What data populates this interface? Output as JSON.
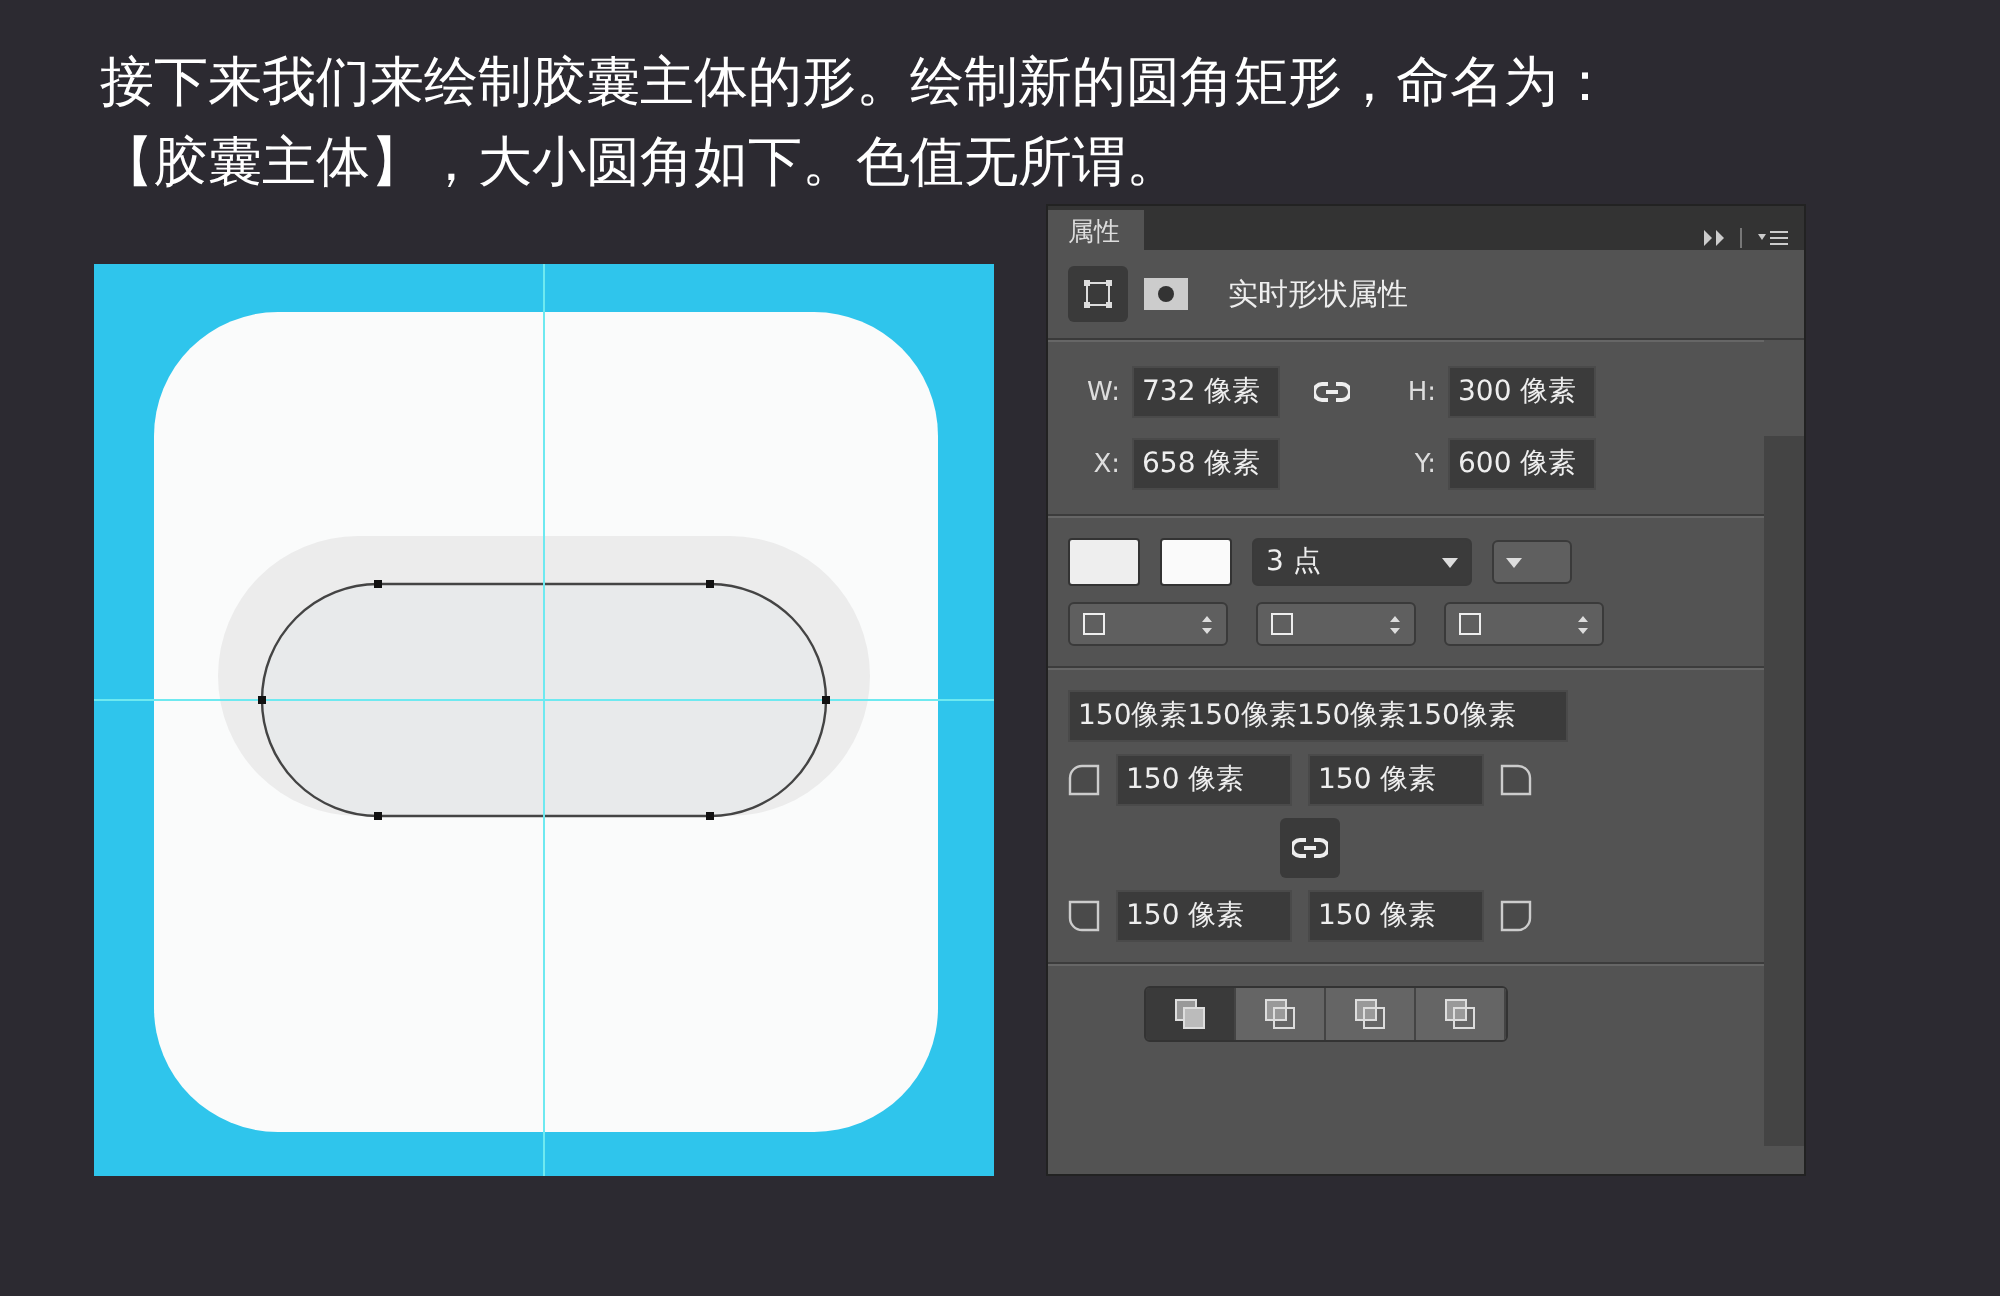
{
  "instruction": {
    "lines": [
      "接下来我们来绘制胶囊主体的形。绘制新的圆角矩形，命名为：",
      "【胶囊主体】，大小圆角如下。色值无所谓。"
    ]
  },
  "panel": {
    "tab": "属性",
    "mode_buttons": [
      {
        "kind": "shape",
        "selected": true
      },
      {
        "kind": "mask",
        "selected": false
      }
    ],
    "header": "实时形状属性",
    "size": [
      {
        "label": "W:",
        "value": "732 像素"
      },
      {
        "label": "H:",
        "value": "300 像素"
      }
    ],
    "position": [
      {
        "label": "X:",
        "value": "658 像素"
      },
      {
        "label": "Y:",
        "value": "600 像素"
      }
    ],
    "stroke_width": "3 点",
    "corners_all": "150像素150像素150像素150像素",
    "corners": [
      "150 像素",
      "150 像素",
      "150 像素",
      "150 像素"
    ],
    "path_ops": [
      {
        "selected": true
      },
      {
        "selected": false
      },
      {
        "selected": false
      },
      {
        "selected": false
      }
    ]
  }
}
